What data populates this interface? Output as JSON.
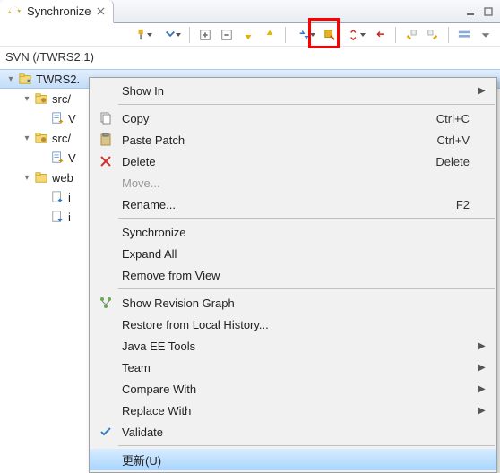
{
  "tab": {
    "label": "Synchronize"
  },
  "path": "SVN (/TWRS2.1)",
  "tree": {
    "root": "TWRS2.",
    "n1": "src/",
    "n2": "V",
    "n3": "src/",
    "n4": "V",
    "n5": "web",
    "n6": "i",
    "n7": "i"
  },
  "menu": {
    "showIn": {
      "label": "Show In"
    },
    "copy": {
      "label": "Copy",
      "shortcut": "Ctrl+C"
    },
    "pastePatch": {
      "label": "Paste Patch",
      "shortcut": "Ctrl+V"
    },
    "delete": {
      "label": "Delete",
      "shortcut": "Delete"
    },
    "move": {
      "label": "Move..."
    },
    "rename": {
      "label": "Rename...",
      "shortcut": "F2"
    },
    "synchronize": {
      "label": "Synchronize"
    },
    "expandAll": {
      "label": "Expand All"
    },
    "removeFromView": {
      "label": "Remove from View"
    },
    "showRevisionGraph": {
      "label": "Show Revision Graph"
    },
    "restoreLocal": {
      "label": "Restore from Local History..."
    },
    "javaEETools": {
      "label": "Java EE Tools"
    },
    "team": {
      "label": "Team"
    },
    "compareWith": {
      "label": "Compare With"
    },
    "replaceWith": {
      "label": "Replace With"
    },
    "validate": {
      "label": "Validate"
    },
    "update": {
      "label": "更新(U)"
    }
  },
  "icons": {
    "sync": "sync",
    "close": "×"
  }
}
